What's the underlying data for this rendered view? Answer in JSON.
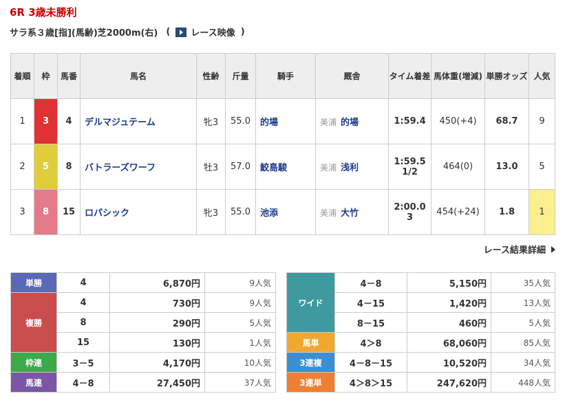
{
  "race": {
    "title": "6R 3歳未勝利",
    "detail": "サラ系３歳[指](馬齢)芝2000m(右)",
    "video_label": "レース映像"
  },
  "table_headers": {
    "rank": "着順",
    "waku": "枠",
    "umaban": "馬番",
    "name": "馬名",
    "sex_age": "性齢",
    "weight": "斤量",
    "jockey": "騎手",
    "stable": "厩舎",
    "time": "タイム着差",
    "body_weight": "馬体重(増減)",
    "odds": "単勝オッズ",
    "popularity": "人気"
  },
  "rows": [
    {
      "rank": "1",
      "waku": "3",
      "umaban": "4",
      "name": "デルマジュテーム",
      "sex_age": "牝3",
      "weight": "55.0",
      "jockey": "的場",
      "region": "美浦",
      "trainer": "的場",
      "time": "1:59.4",
      "margin": "",
      "body_weight": "450(+4)",
      "odds": "68.7",
      "popularity": "9"
    },
    {
      "rank": "2",
      "waku": "5",
      "umaban": "8",
      "name": "バトラーズワーフ",
      "sex_age": "牡3",
      "weight": "57.0",
      "jockey": "鮫島駿",
      "region": "美浦",
      "trainer": "浅利",
      "time": "1:59.5",
      "margin": "1/2",
      "body_weight": "464(0)",
      "odds": "13.0",
      "popularity": "5"
    },
    {
      "rank": "3",
      "waku": "8",
      "umaban": "15",
      "name": "ロパシック",
      "sex_age": "牝3",
      "weight": "55.0",
      "jockey": "池添",
      "region": "美浦",
      "trainer": "大竹",
      "time": "2:00.0",
      "margin": "3",
      "body_weight": "454(+24)",
      "odds": "1.8",
      "popularity": "1"
    }
  ],
  "detail_link": "レース結果詳細",
  "payouts_left": {
    "tansho": {
      "label": "単勝",
      "items": [
        {
          "combo": "4",
          "amount": "6,870円",
          "pop": "9人気"
        }
      ]
    },
    "fukusho": {
      "label": "複勝",
      "items": [
        {
          "combo": "4",
          "amount": "730円",
          "pop": "9人気"
        },
        {
          "combo": "8",
          "amount": "290円",
          "pop": "5人気"
        },
        {
          "combo": "15",
          "amount": "130円",
          "pop": "1人気"
        }
      ]
    },
    "wakuren": {
      "label": "枠連",
      "items": [
        {
          "combo": "3－5",
          "amount": "4,170円",
          "pop": "10人気"
        }
      ]
    },
    "umaren": {
      "label": "馬連",
      "items": [
        {
          "combo": "4－8",
          "amount": "27,450円",
          "pop": "37人気"
        }
      ]
    }
  },
  "payouts_right": {
    "wide": {
      "label": "ワイド",
      "items": [
        {
          "combo": "4－8",
          "amount": "5,150円",
          "pop": "35人気"
        },
        {
          "combo": "4－15",
          "amount": "1,420円",
          "pop": "13人気"
        },
        {
          "combo": "8－15",
          "amount": "460円",
          "pop": "5人気"
        }
      ]
    },
    "umatan": {
      "label": "馬単",
      "items": [
        {
          "combo": "4＞8",
          "amount": "68,060円",
          "pop": "85人気"
        }
      ]
    },
    "sanrenpuku": {
      "label": "3連複",
      "items": [
        {
          "combo": "4－8－15",
          "amount": "10,520円",
          "pop": "34人気"
        }
      ]
    },
    "sanrentan": {
      "label": "3連単",
      "items": [
        {
          "combo": "4＞8＞15",
          "amount": "247,620円",
          "pop": "448人気"
        }
      ]
    }
  }
}
